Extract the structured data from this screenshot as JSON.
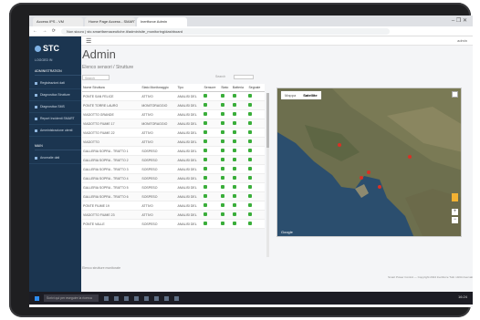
{
  "browser": {
    "tabs": [
      "Access IPS - VM",
      "Home Page Access - SMART ...",
      "Inertforce Admin"
    ],
    "active_tab": 2,
    "window_controls": "–  ❐  ✕",
    "nav_buttons": "← → ⟳",
    "url": "Non sicuro | stc.smartfarmaceutiche.it/admin/site_monitoring/dashboard"
  },
  "sidebar": {
    "logo": "STC",
    "user": "LOGGED IN",
    "section": "ADMINISTRATION",
    "items": [
      "Registrazioni dati",
      "Diagnostica Strutture",
      "Diagnostica SMS",
      "Report Incidenti SMART",
      "Amministrazione utenti"
    ],
    "section2": "MAIN",
    "items2": [
      "Anomalie dati"
    ]
  },
  "topbar": {
    "menu_icon": "☰",
    "right_text": "admin"
  },
  "page": {
    "title": "Admin",
    "subtitle": "Elenco sensori / Strutture",
    "search_placeholder": "Search",
    "search_label": "Search",
    "footer": "Elenco strutture monitorate",
    "copyright": "Smart Power Control — Copyright 2024 Inertforce Tutti i diritti riservati"
  },
  "table": {
    "columns": [
      "Nome Struttura",
      "Stato Monitoraggio",
      "Tipo",
      "Sensore",
      "Stato",
      "Batteria",
      "Segnale"
    ],
    "rows": [
      [
        "PONTE SAN FELICE",
        "ATTIVO",
        "ANALISI DEL",
        "ok",
        "ok",
        "ok",
        "ok"
      ],
      [
        "PONTE TORRE LAURO",
        "MONITORAGGIO",
        "ANALISI DEL",
        "ok",
        "ok",
        "ok",
        "ok"
      ],
      [
        "VIADOTTO GRANDE",
        "ATTIVO",
        "ANALISI DEL",
        "ok",
        "ok",
        "ok",
        "ok"
      ],
      [
        "VIADOTTO FIUME 17",
        "MONITORAGGIO",
        "ANALISI DEL",
        "ok",
        "ok",
        "ok",
        "ok"
      ],
      [
        "VIADOTTO FIUME 22",
        "ATTIVO",
        "ANALISI DEL",
        "ok",
        "ok",
        "ok",
        "ok"
      ],
      [
        "VIADOTTO",
        "ATTIVO",
        "ANALISI DEL",
        "ok",
        "ok",
        "ok",
        "ok"
      ],
      [
        "GALLERIA SOPRA - TRATTO 1",
        "SOSPESO",
        "ANALISI DEL",
        "ok",
        "ok",
        "ok",
        "ok"
      ],
      [
        "GALLERIA SOPRA - TRATTO 2",
        "SOSPESO",
        "ANALISI DEL",
        "ok",
        "ok",
        "ok",
        "ok"
      ],
      [
        "GALLERIA SOPRA - TRATTO 3",
        "SOSPESO",
        "ANALISI DEL",
        "ok",
        "ok",
        "ok",
        "ok"
      ],
      [
        "GALLERIA SOPRA - TRATTO 4",
        "SOSPESO",
        "ANALISI DEL",
        "ok",
        "ok",
        "ok",
        "ok"
      ],
      [
        "GALLERIA SOPRA - TRATTO 5",
        "SOSPESO",
        "ANALISI DEL",
        "ok",
        "ok",
        "ok",
        "ok"
      ],
      [
        "GALLERIA SOPRA - TRATTO 6",
        "SOSPESO",
        "ANALISI DEL",
        "ok",
        "ok",
        "ok",
        "ok"
      ],
      [
        "PONTE FIUME 19",
        "ATTIVO",
        "ANALISI DEL",
        "ok",
        "ok",
        "ok",
        "ok"
      ],
      [
        "VIADOTTO FIUME 23",
        "ATTIVO",
        "ANALISI DEL",
        "ok",
        "ok",
        "ok",
        "ok"
      ],
      [
        "PONTE VALLE",
        "SOSPESO",
        "ANALISI DEL",
        "ok",
        "ok",
        "ok",
        "ok"
      ]
    ]
  },
  "map": {
    "tabs": [
      "Mappa",
      "Satellite"
    ],
    "active_tab": 1,
    "google_label": "Google",
    "zoom_in": "+",
    "zoom_out": "−"
  },
  "taskbar": {
    "search_placeholder": "Scrivi qui per eseguire la ricerca",
    "time": "16:24"
  },
  "colors": {
    "sidebar_bg": "#1b3550",
    "ok_green": "#3aae3a",
    "marker_red": "#d93025"
  }
}
